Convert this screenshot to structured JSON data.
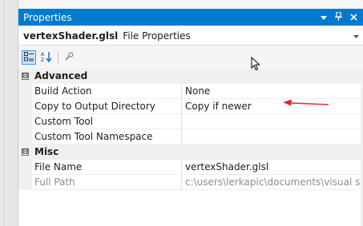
{
  "panel": {
    "title": "Properties",
    "title_icons": [
      "dropdown-icon",
      "pin-icon",
      "close-icon"
    ],
    "object": {
      "file_name": "vertexShader.glsl",
      "type": "File Properties"
    },
    "toolbar": {
      "buttons": [
        "categorized-icon",
        "alphabetical-icon",
        "property-pages-icon"
      ]
    }
  },
  "grid": {
    "categories": [
      {
        "label": "Advanced",
        "expander": "⊟",
        "rows": [
          {
            "name": "Build Action",
            "value": "None"
          },
          {
            "name": "Copy to Output Directory",
            "value": "Copy if newer"
          },
          {
            "name": "Custom Tool",
            "value": ""
          },
          {
            "name": "Custom Tool Namespace",
            "value": ""
          }
        ]
      },
      {
        "label": "Misc",
        "expander": "⊟",
        "rows": [
          {
            "name": "File Name",
            "value": "vertexShader.glsl"
          },
          {
            "name": "Full Path",
            "value": "c:\\users\\lerkapic\\documents\\visual stud"
          }
        ]
      }
    ]
  },
  "colors": {
    "titlebar": "#007acc",
    "annotation_arrow": "#e8262b"
  }
}
